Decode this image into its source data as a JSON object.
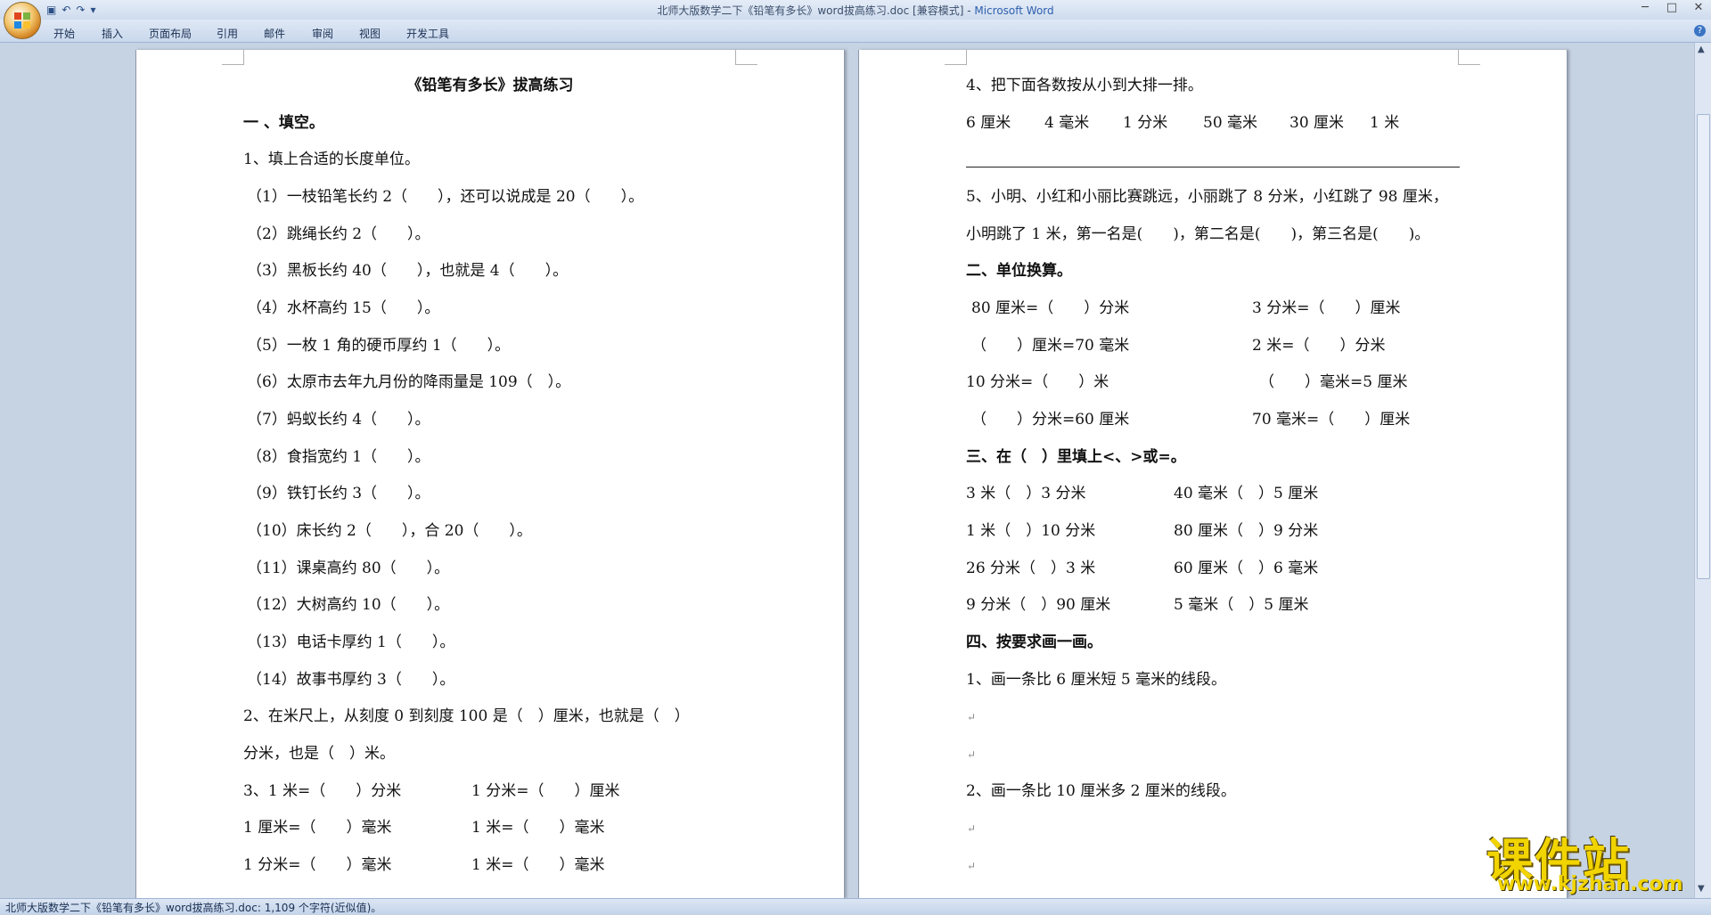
{
  "window": {
    "title": "北师大版数学二下《铅笔有多长》word拔高练习.doc [兼容模式] - ",
    "app_name": "Microsoft Word"
  },
  "qat": {
    "save_icon": "save-icon",
    "undo_label": "↶",
    "redo_label": "↷",
    "more_label": "▾"
  },
  "window_controls": {
    "minimize": "─",
    "maximize": "□",
    "close": "✕"
  },
  "ribbon_tabs": [
    "开始",
    "插入",
    "页面布局",
    "引用",
    "邮件",
    "审阅",
    "视图",
    "开发工具"
  ],
  "page1": {
    "title": "《铅笔有多长》拔高练习",
    "section1": "一 、填空。",
    "lines": [
      "1、填上合适的长度单位。",
      "（1）一枝铅笔长约 2（　　），还可以说成是 20（　　）。",
      "（2）跳绳长约 2（　　）。",
      "（3）黑板长约 40（　　），也就是 4（　　）。",
      "（4）水杯高约 15（　　）。",
      "（5）一枚 1 角的硬币厚约 1（　　）。",
      "（6）太原市去年九月份的降雨量是 109（　）。",
      "（7）蚂蚁长约 4（　　）。",
      "（8）食指宽约 1（　　）。",
      "（9）铁钉长约 3（　　）。",
      "（10）床长约 2（　　），合 20（　　）。",
      "（11）课桌高约 80（　　）。",
      "（12）大树高约 10（　　）。",
      "（13）电话卡厚约 1（　　）。",
      "（14）故事书厚约 3（　　）。",
      "2、在米尺上，从刻度 0 到刻度 100 是（　）厘米，也就是（　）",
      "分米，也是（　）米。"
    ],
    "conv_rows": [
      [
        "3、1 米=（　　）分米",
        "1 分米=（　　）厘米"
      ],
      [
        "1 厘米=（　　）毫米",
        "1 米=（　　）毫米"
      ],
      [
        "1 分米=（　　）毫米",
        "1 米=（　　）毫米"
      ]
    ]
  },
  "page2": {
    "q4": "4、把下面各数按从小到大排一排。",
    "q4_items": [
      "6 厘米",
      "4 毫米",
      "1 分米",
      "50 毫米",
      "30 厘米",
      "1 米"
    ],
    "q5_a": "5、小明、小红和小丽比赛跳远，小丽跳了 8 分米，小红跳了 98 厘米，",
    "q5_b": "小明跳了 1 米，第一名是(　　)，第二名是(　　)，第三名是(　　)。",
    "section2": "二、单位换算。",
    "conv": [
      [
        "80 厘米=（　　）分米",
        "3 分米=（　　）厘米"
      ],
      [
        "（　　）厘米=70 毫米",
        "2 米=（　　）分米"
      ],
      [
        "10 分米=（　　）米",
        "（　　）毫米=5 厘米"
      ],
      [
        "（　　）分米=60 厘米",
        "70 毫米=（　　）厘米"
      ]
    ],
    "section3": "三、在（　）里填上<、>或=。",
    "compare": [
      [
        "3 米（　）3 分米",
        "40 毫米（　）5 厘米"
      ],
      [
        "1 米（　）10 分米",
        "80 厘米（　）9 分米"
      ],
      [
        "26 分米（　）3 米",
        "60 厘米（　）6 毫米"
      ],
      [
        "9 分米（　）90 厘米",
        "5 毫米（　）5 厘米"
      ]
    ],
    "section4": "四、按要求画一画。",
    "draw1": "1、画一条比 6 厘米短 5 毫米的线段。",
    "draw2": "2、画一条比 10 厘米多 2 厘米的线段。"
  },
  "paragraph_mark": "↵",
  "statusbar": {
    "text": "北师大版数学二下《铅笔有多长》word拔高练习.doc: 1,109 个字符(近似值)。"
  },
  "watermark": {
    "big": "课件站",
    "small": "www.kjzhan.com"
  }
}
